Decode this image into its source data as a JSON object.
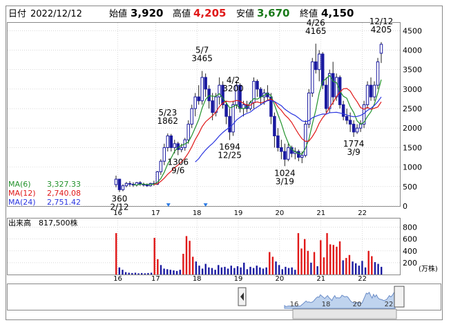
{
  "header": {
    "date_label": "日付",
    "date": "2022/12/12",
    "open_label": "始値",
    "open": "3,920",
    "high_label": "高値",
    "high": "4,205",
    "low_label": "安値",
    "low": "3,670",
    "close_label": "終値",
    "close": "4,150"
  },
  "legend": [
    {
      "name": "MA(6)",
      "value": "3,327.33",
      "color": "#22922b"
    },
    {
      "name": "MA(12)",
      "value": "2,740.08",
      "color": "#e01818"
    },
    {
      "name": "MA(24)",
      "value": "2,751.42",
      "color": "#2a35e0"
    }
  ],
  "volume_label": "出来高",
  "volume_value": "817,500株",
  "volume_unit": "(万株)",
  "colors": {
    "up": "#1a1aa0",
    "up_light": "#2c7be5",
    "vol_up": "#e01818",
    "vol_down": "#1a1aa0",
    "grid": "#c0c0c0",
    "navigator": "#bfd3ee"
  },
  "navigator_years": [
    "16",
    "18",
    "20",
    "22"
  ],
  "chart_data": [
    {
      "type": "candlestick",
      "x_tick_labels": [
        "16",
        "17",
        "18",
        "19",
        "20",
        "21",
        "22"
      ],
      "y_ticks": [
        0,
        500,
        1000,
        1500,
        2000,
        2500,
        3000,
        3500,
        4000,
        4500
      ],
      "ylim": [
        0,
        4700
      ],
      "annotations": [
        {
          "text": [
            "360",
            "2/12"
          ],
          "value": 360
        },
        {
          "text": [
            "5/23",
            "1862"
          ],
          "value": 1862
        },
        {
          "text": [
            "1306",
            "9/6"
          ],
          "value": 1306
        },
        {
          "text": [
            "5/7",
            "3465"
          ],
          "value": 3465
        },
        {
          "text": [
            "4/2",
            "3200"
          ],
          "value": 3200
        },
        {
          "text": [
            "1694",
            "12/25"
          ],
          "value": 1694
        },
        {
          "text": [
            "1024",
            "3/19"
          ],
          "value": 1024
        },
        {
          "text": [
            "4/26",
            "4165"
          ],
          "value": 4165
        },
        {
          "text": [
            "1774",
            "3/9"
          ],
          "value": 1774
        },
        {
          "text": [
            "12/12",
            "4205"
          ],
          "value": 4205
        }
      ],
      "markers": [
        "17",
        "18"
      ],
      "bars": [
        [
          550,
          780,
          480,
          690
        ],
        [
          690,
          700,
          360,
          420
        ],
        [
          420,
          560,
          380,
          520
        ],
        [
          520,
          620,
          480,
          580
        ],
        [
          580,
          640,
          500,
          560
        ],
        [
          560,
          610,
          490,
          540
        ],
        [
          540,
          620,
          500,
          600
        ],
        [
          600,
          640,
          520,
          560
        ],
        [
          560,
          600,
          500,
          540
        ],
        [
          540,
          580,
          490,
          520
        ],
        [
          520,
          600,
          500,
          580
        ],
        [
          580,
          650,
          520,
          560
        ],
        [
          560,
          900,
          540,
          880
        ],
        [
          880,
          1200,
          800,
          1150
        ],
        [
          1150,
          1600,
          1050,
          1500
        ],
        [
          1500,
          1862,
          1400,
          1800
        ],
        [
          1800,
          1850,
          1400,
          1500
        ],
        [
          1500,
          1700,
          1350,
          1600
        ],
        [
          1600,
          1650,
          1306,
          1450
        ],
        [
          1450,
          1600,
          1380,
          1500
        ],
        [
          1500,
          1750,
          1420,
          1700
        ],
        [
          1700,
          2200,
          1600,
          2100
        ],
        [
          2100,
          2600,
          2000,
          2500
        ],
        [
          2500,
          2900,
          2300,
          2800
        ],
        [
          2800,
          3100,
          2600,
          2700
        ],
        [
          2700,
          3465,
          2600,
          3300
        ],
        [
          3300,
          3400,
          2800,
          3000
        ],
        [
          3000,
          3100,
          2500,
          2700
        ],
        [
          2700,
          2900,
          2200,
          2400
        ],
        [
          2400,
          2900,
          2300,
          2800
        ],
        [
          2800,
          3300,
          2600,
          3100
        ],
        [
          3100,
          3200,
          2500,
          2600
        ],
        [
          2600,
          2700,
          2100,
          2300
        ],
        [
          2300,
          2500,
          1694,
          1900
        ],
        [
          1900,
          2700,
          1800,
          2600
        ],
        [
          2600,
          3200,
          2500,
          3100
        ],
        [
          3100,
          3150,
          2400,
          2500
        ],
        [
          2500,
          2700,
          2300,
          2600
        ],
        [
          2600,
          2700,
          2400,
          2500
        ],
        [
          2500,
          2700,
          2450,
          2650
        ],
        [
          2650,
          3300,
          2500,
          3200
        ],
        [
          3200,
          3250,
          2800,
          3000
        ],
        [
          3000,
          3050,
          2600,
          2800
        ],
        [
          2800,
          3000,
          2600,
          2900
        ],
        [
          2900,
          3100,
          2700,
          2800
        ],
        [
          2800,
          2900,
          2100,
          2300
        ],
        [
          2300,
          2400,
          1500,
          1800
        ],
        [
          1800,
          2000,
          1400,
          1500
        ],
        [
          1500,
          1700,
          1200,
          1400
        ],
        [
          1400,
          1600,
          1024,
          1200
        ],
        [
          1200,
          1600,
          1150,
          1500
        ],
        [
          1500,
          1550,
          1250,
          1350
        ],
        [
          1350,
          1500,
          1200,
          1400
        ],
        [
          1400,
          1450,
          1150,
          1250
        ],
        [
          1250,
          1400,
          1100,
          1300
        ],
        [
          1300,
          2200,
          1250,
          2100
        ],
        [
          2100,
          3000,
          2000,
          2900
        ],
        [
          2900,
          3800,
          2800,
          3700
        ],
        [
          3700,
          4165,
          3400,
          3500
        ],
        [
          3500,
          4000,
          3200,
          3900
        ],
        [
          3900,
          3950,
          3000,
          3100
        ],
        [
          3100,
          3300,
          2400,
          2500
        ],
        [
          2500,
          3500,
          2400,
          3400
        ],
        [
          3400,
          3700,
          2600,
          2800
        ],
        [
          2800,
          3400,
          2700,
          3300
        ],
        [
          3300,
          3350,
          2500,
          2600
        ],
        [
          2600,
          2700,
          2200,
          2300
        ],
        [
          2300,
          2500,
          2100,
          2200
        ],
        [
          2200,
          2400,
          1900,
          2100
        ],
        [
          2100,
          2200,
          1774,
          1900
        ],
        [
          1900,
          2100,
          1850,
          2000
        ],
        [
          2000,
          2200,
          1900,
          2100
        ],
        [
          2100,
          2700,
          2000,
          2600
        ],
        [
          2600,
          3200,
          2500,
          3100
        ],
        [
          3100,
          3300,
          2700,
          2800
        ],
        [
          2800,
          3200,
          2700,
          3100
        ],
        [
          3100,
          3800,
          3000,
          3700
        ],
        [
          3920,
          4205,
          3670,
          4150
        ]
      ],
      "x_tick_index": [
        0,
        11,
        23,
        35,
        47,
        59,
        71
      ],
      "ma6_last": 3327.33,
      "ma12_last": 2740.08,
      "ma24_last": 2751.42
    },
    {
      "type": "bar",
      "name": "volume",
      "y_ticks": [
        200,
        400,
        600,
        800
      ],
      "ylim": [
        0,
        900
      ],
      "values": [
        700,
        120,
        80,
        40,
        30,
        25,
        30,
        20,
        25,
        20,
        25,
        30,
        620,
        260,
        160,
        100,
        90,
        80,
        70,
        60,
        80,
        350,
        650,
        570,
        300,
        220,
        150,
        100,
        180,
        120,
        110,
        80,
        160,
        120,
        130,
        100,
        150,
        110,
        140,
        120,
        200,
        90,
        130,
        110,
        150,
        120,
        100,
        120,
        380,
        300,
        220,
        160,
        90,
        130,
        110,
        120,
        80,
        700,
        440,
        600,
        400,
        200,
        380,
        140,
        580,
        290,
        700,
        510,
        500,
        470,
        560,
        240,
        280,
        330,
        220,
        190,
        150,
        230,
        120,
        400,
        310,
        210,
        180,
        130
      ]
    }
  ]
}
